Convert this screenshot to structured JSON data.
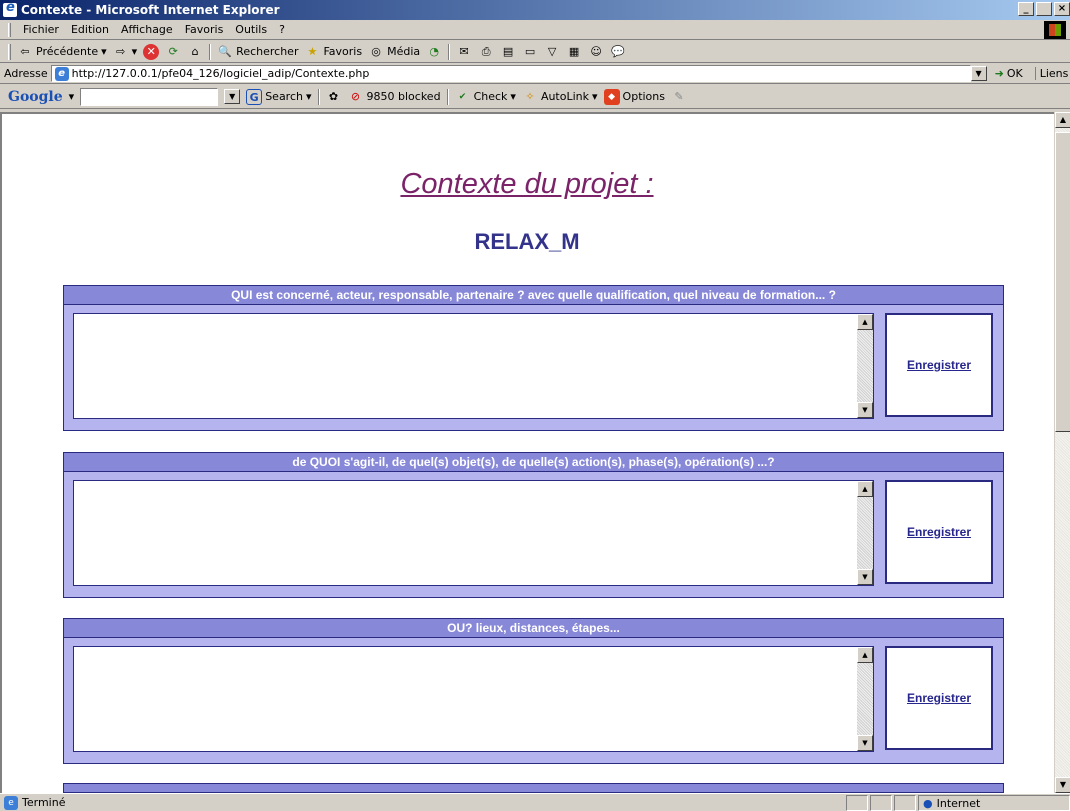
{
  "window": {
    "title": "Contexte - Microsoft Internet Explorer",
    "minimize": "_",
    "maximize": " ",
    "close": "×"
  },
  "menu": [
    "Fichier",
    "Edition",
    "Affichage",
    "Favoris",
    "Outils",
    "?"
  ],
  "toolbar": {
    "back": "Précédente",
    "search": "Rechercher",
    "favorites": "Favoris",
    "media": "Média"
  },
  "address": {
    "label": "Adresse",
    "url": "http://127.0.0.1/pfe04_126/logiciel_adip/Contexte.php",
    "go": "OK",
    "links": "Liens"
  },
  "google": {
    "logo": "Google",
    "search": "Search",
    "blocked": "9850 blocked",
    "check": "Check",
    "autolink": "AutoLink",
    "options": "Options"
  },
  "page": {
    "title": "Contexte du projet :",
    "project": "RELAX_M",
    "sections": [
      {
        "header": "QUI est concerné, acteur, responsable, partenaire ? avec quelle qualification, quel niveau de formation... ?",
        "value": "",
        "save": "Enregistrer"
      },
      {
        "header": "de QUOI s'agit-il, de quel(s) objet(s), de quelle(s) action(s), phase(s), opération(s) ...?",
        "value": "",
        "save": "Enregistrer"
      },
      {
        "header": "OU? lieux, distances, étapes...",
        "value": "",
        "save": "Enregistrer"
      }
    ]
  },
  "status": {
    "text": "Terminé",
    "zone": "Internet"
  }
}
